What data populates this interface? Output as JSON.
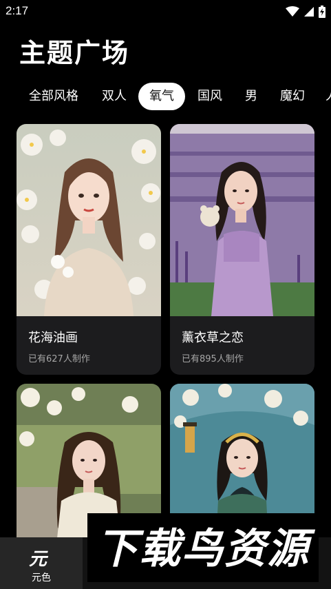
{
  "status_bar": {
    "time": "2:17",
    "icons": [
      "wifi-icon",
      "signal-icon",
      "battery-charging-icon"
    ]
  },
  "page": {
    "title": "主题广场"
  },
  "tabs": [
    {
      "label": "全部风格",
      "active": false
    },
    {
      "label": "双人",
      "active": false
    },
    {
      "label": "氧气",
      "active": true
    },
    {
      "label": "国风",
      "active": false
    },
    {
      "label": "男",
      "active": false
    },
    {
      "label": "魔幻",
      "active": false
    },
    {
      "label": "人",
      "active": false
    }
  ],
  "cards": [
    {
      "title": "花海油画",
      "count": "已有627人制作"
    },
    {
      "title": "薰衣草之恋",
      "count": "已有895人制作"
    },
    {
      "title": "",
      "count": ""
    },
    {
      "title": "",
      "count": ""
    }
  ],
  "bottom_nav": {
    "items": [
      {
        "icon_text": "元",
        "label": "元色",
        "icon": "yuanse-logo-icon"
      }
    ]
  },
  "watermark": {
    "text": "下载鸟资源"
  },
  "colors": {
    "background": "#000000",
    "card": "#1c1c1e",
    "muted_text": "#a6a6a6",
    "active_tab_bg": "#ffffff"
  }
}
